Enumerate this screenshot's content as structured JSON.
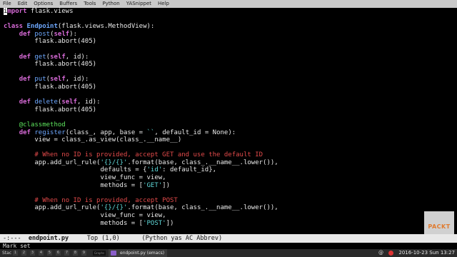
{
  "menubar": {
    "items": [
      "File",
      "Edit",
      "Options",
      "Buffers",
      "Tools",
      "Python",
      "YASnippet",
      "Help"
    ]
  },
  "code": {
    "l1_kw": "import",
    "l1_rest": " flask.views",
    "l3_kw": "class",
    "l3_name": "Endpoint",
    "l3_rest": "(flask.views.MethodView):",
    "l4_kw": "def",
    "l4_name": "post",
    "l4_self": "self",
    "l4_rest": "):",
    "l5": "        flask.abort(405)",
    "l7_kw": "def",
    "l7_name": "get",
    "l7_self": "self",
    "l7_rest": ", id):",
    "l8": "        flask.abort(405)",
    "l10_kw": "def",
    "l10_name": "put",
    "l10_self": "self",
    "l10_rest": ", id):",
    "l11": "        flask.abort(405)",
    "l13_kw": "def",
    "l13_name": "delete",
    "l13_self": "self",
    "l13_rest": ", id):",
    "l14": "        flask.abort(405)",
    "l16_deco": "@classmethod",
    "l17_kw": "def",
    "l17_name": "register",
    "l17_rest": "(class_, app, base = ",
    "l17_str": "``",
    "l17_rest2": ", default_id = None):",
    "l18": "        view = class_.as_view(class_.__name__)",
    "l20_cmt": "# When no ID is provided, accept GET and use the default ID",
    "l21_a": "        app.add_url_rule(",
    "l21_str": "'{}/{}'",
    "l21_b": ".format(base, class_.__name__.lower()),",
    "l22_a": "                         defaults = {",
    "l22_str": "'id'",
    "l22_b": ": default_id},",
    "l23": "                         view_func = view,",
    "l24_a": "                         methods = [",
    "l24_str": "'GET'",
    "l24_b": "])",
    "l26_cmt": "# When no ID is provided, accept POST",
    "l27_a": "        app.add_url_rule(",
    "l27_str": "'{}/{}'",
    "l27_b": ".format(base, class_.__name__.lower()),",
    "l28": "                         view_func = view,",
    "l29_a": "                         methods = [",
    "l29_str": "'POST'",
    "l29_b": "])"
  },
  "modeline": {
    "status": "-:---  ",
    "buffer": "endpoint.py",
    "position": "     Top (1,0)      ",
    "modes": "(Python yas AC Abbrev)"
  },
  "minibuffer": {
    "message": "Mark set"
  },
  "taskbar": {
    "workspace": "Stac",
    "desktops": [
      "1",
      "2",
      "3",
      "4",
      "5",
      "6",
      "7",
      "8",
      "9"
    ],
    "graph_label": "Graphs",
    "task_title": "endpoint.py (emacs)",
    "at_symbol": "@",
    "clock": "2016-10-23 Sun 13:27"
  },
  "logo": {
    "text": "PACKT"
  },
  "colors": {
    "keyword": "#d76ad7",
    "function": "#6ea8ff",
    "decorator": "#5ee65e",
    "comment": "#e24a4a",
    "string": "#5fd7d7"
  }
}
